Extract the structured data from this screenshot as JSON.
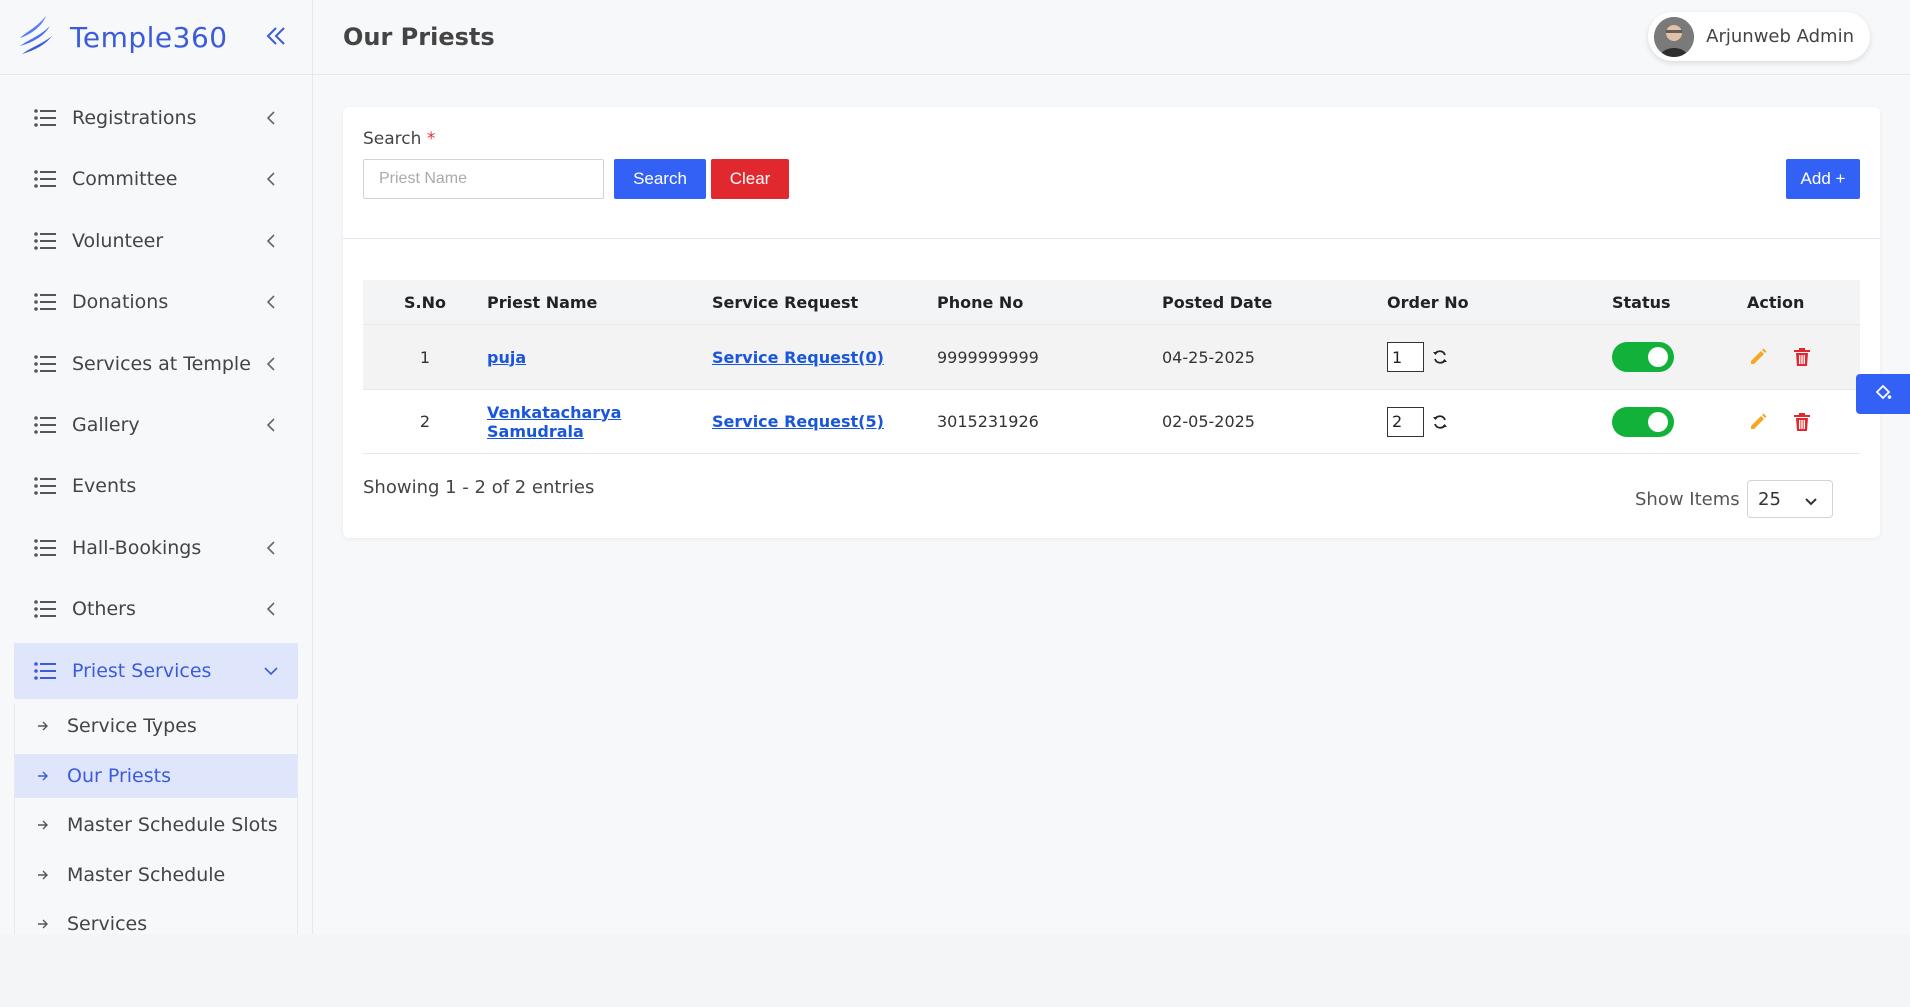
{
  "app": {
    "name": "Temple360"
  },
  "header": {
    "page_title": "Our Priests",
    "user_name": "Arjunweb Admin"
  },
  "sidebar": {
    "items": [
      {
        "label": "Registrations",
        "has_children": true
      },
      {
        "label": "Committee",
        "has_children": true
      },
      {
        "label": "Volunteer",
        "has_children": true
      },
      {
        "label": "Donations",
        "has_children": true
      },
      {
        "label": "Services at Temple",
        "has_children": true
      },
      {
        "label": "Gallery",
        "has_children": true
      },
      {
        "label": "Events",
        "has_children": false
      },
      {
        "label": "Hall-Bookings",
        "has_children": true
      },
      {
        "label": "Others",
        "has_children": true
      },
      {
        "label": "Priest Services",
        "has_children": true,
        "expanded": true
      }
    ],
    "sub_items": [
      {
        "label": "Service Types"
      },
      {
        "label": "Our Priests",
        "active": true
      },
      {
        "label": "Master Schedule Slots"
      },
      {
        "label": "Master Schedule"
      },
      {
        "label": "Services"
      }
    ]
  },
  "search": {
    "label": "Search",
    "required_mark": "*",
    "placeholder": "Priest Name",
    "value": "",
    "search_label": "Search",
    "clear_label": "Clear",
    "add_label": "Add +"
  },
  "table": {
    "columns": [
      "S.No",
      "Priest Name",
      "Service Request",
      "Phone No",
      "Posted Date",
      "Order No",
      "Status",
      "Action"
    ],
    "rows": [
      {
        "sno": "1",
        "name": "puja",
        "service_request": "Service Request(0)",
        "phone": "9999999999",
        "posted_date": "04-25-2025",
        "order_no": "1",
        "status": "active"
      },
      {
        "sno": "2",
        "name": "Venkatacharya Samudrala",
        "service_request": "Service Request(5)",
        "phone": "3015231926",
        "posted_date": "02-05-2025",
        "order_no": "2",
        "status": "active"
      }
    ]
  },
  "pagination": {
    "showing_text": "Showing 1 - 2 of 2 entries",
    "show_items_label": "Show Items",
    "page_size": "25"
  },
  "colors": {
    "primary": "#3461f5",
    "danger": "#e0282e",
    "success": "#12b23a",
    "edit": "#f5a623",
    "brand": "#3b5bdb"
  }
}
